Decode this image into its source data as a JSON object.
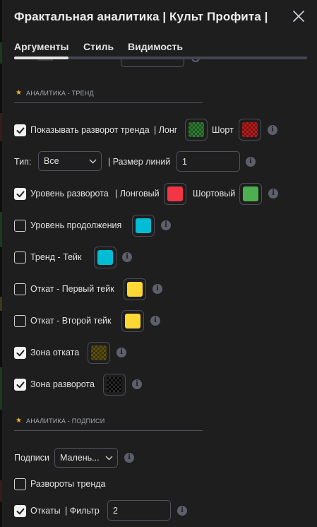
{
  "dialog": {
    "title": "Фрактальная аналитика | Культ Профита |"
  },
  "tabs": [
    {
      "label": "Аргументы"
    },
    {
      "label": "Стиль"
    },
    {
      "label": "Видимость"
    }
  ],
  "colors": {
    "accent_star": "#f0b23e",
    "long_trend": "#2e7d32",
    "short_trend": "#b71c1c",
    "reversal_long": "#f23645",
    "reversal_short": "#4caf50",
    "continuation": "#00bcd4",
    "trend_take": "#00bcd4",
    "first_take": "#fdd835",
    "second_take": "#fdd835",
    "pullback_zone": "#5a4f12",
    "reversal_zone": "#050505"
  },
  "trend_section": {
    "header": "АНАЛИТИКА - ТРЕНД",
    "show_reversal": {
      "label": "Показывать разворот тренда",
      "checked": true,
      "long_label": "| Лонг",
      "short_label": "Шорт"
    },
    "type": {
      "label": "Тип:",
      "value": "Все",
      "line_size_label": "| Размер линий",
      "line_size_value": "1"
    },
    "reversal_level": {
      "label": "Уровень разворота",
      "checked": true,
      "long_label": "| Лонговый",
      "short_label": "Шортовый"
    },
    "continuation_level": {
      "label": "Уровень продолжения",
      "checked": false
    },
    "trend_take": {
      "label": "Тренд - Тейк",
      "checked": false
    },
    "first_take": {
      "label": "Откат - Первый тейк",
      "checked": false
    },
    "second_take": {
      "label": "Откат - Второй тейк",
      "checked": false
    },
    "pullback_zone": {
      "label": "Зона отката",
      "checked": true
    },
    "reversal_zone": {
      "label": "Зона разворота",
      "checked": true
    }
  },
  "labels_section": {
    "header": "АНАЛИТИКА - ПОДПИСИ",
    "labels": {
      "label": "Подписи",
      "value": "Малень..."
    },
    "trend_reversals": {
      "label": "Развороты тренда",
      "checked": false
    },
    "pullbacks": {
      "label": "Откаты",
      "checked": true,
      "filter_label": "| Фильтр",
      "filter_value": "2"
    }
  }
}
